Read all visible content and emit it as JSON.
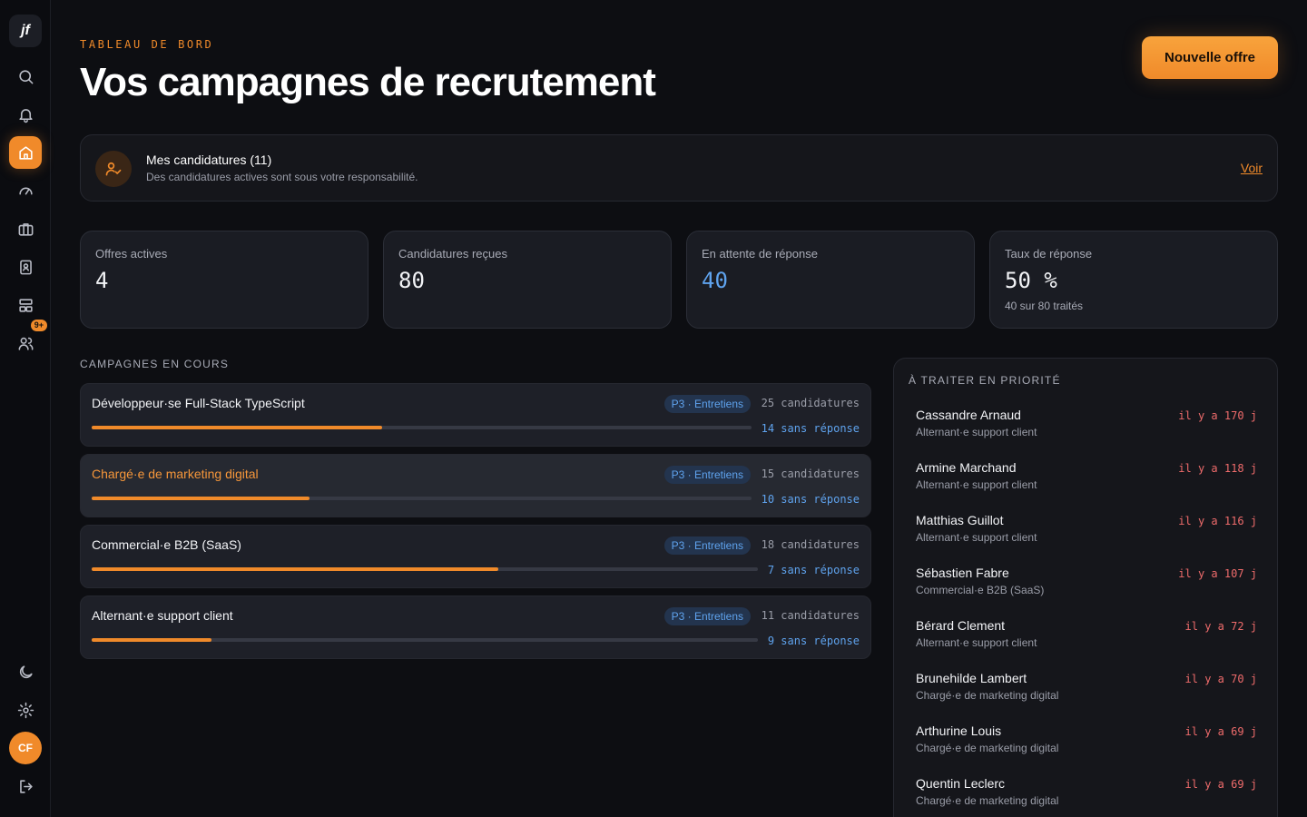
{
  "app": {
    "logo_text": "jf"
  },
  "sidebar": {
    "items": [
      {
        "id": "search",
        "icon": "search-icon"
      },
      {
        "id": "notifications",
        "icon": "bell-icon"
      },
      {
        "id": "home",
        "icon": "home-icon",
        "active": true
      },
      {
        "id": "dashboard",
        "icon": "gauge-icon"
      },
      {
        "id": "jobs",
        "icon": "briefcase-icon"
      },
      {
        "id": "contacts",
        "icon": "contact-book-icon"
      },
      {
        "id": "layout",
        "icon": "layout-icon"
      },
      {
        "id": "team",
        "icon": "users-icon",
        "badge": "9+"
      }
    ],
    "bottom": [
      {
        "id": "theme",
        "icon": "moon-icon"
      },
      {
        "id": "settings",
        "icon": "gear-icon"
      },
      {
        "id": "logout",
        "icon": "logout-icon"
      }
    ],
    "avatar_initials": "CF"
  },
  "header": {
    "eyebrow": "TABLEAU DE BORD",
    "title": "Vos campagnes de recrutement",
    "new_offer_label": "Nouvelle offre"
  },
  "banner": {
    "title": "Mes candidatures (11)",
    "subtitle": "Des candidatures actives sont sous votre responsabilité.",
    "link_label": "Voir"
  },
  "stats": [
    {
      "label": "Offres actives",
      "value": "4"
    },
    {
      "label": "Candidatures reçues",
      "value": "80"
    },
    {
      "label": "En attente de réponse",
      "value": "40"
    },
    {
      "label": "Taux de réponse",
      "value": "50 %",
      "note": "40 sur 80 traités"
    }
  ],
  "campaigns": {
    "section_label": "CAMPAGNES EN COURS",
    "items": [
      {
        "title": "Développeur·se Full-Stack TypeScript",
        "stage": "P3 · Entretiens",
        "count": "25 candidatures",
        "waiting": "14 sans réponse",
        "progress": 0.44
      },
      {
        "title": "Chargé·e de marketing digital",
        "stage": "P3 · Entretiens",
        "count": "15 candidatures",
        "waiting": "10 sans réponse",
        "progress": 0.33
      },
      {
        "title": "Commercial·e B2B (SaaS)",
        "stage": "P3 · Entretiens",
        "count": "18 candidatures",
        "waiting": "7 sans réponse",
        "progress": 0.61
      },
      {
        "title": "Alternant·e support client",
        "stage": "P3 · Entretiens",
        "count": "11 candidatures",
        "waiting": "9 sans réponse",
        "progress": 0.18
      }
    ]
  },
  "priority": {
    "label": "À TRAITER EN PRIORITÉ",
    "items": [
      {
        "name": "Cassandre Arnaud",
        "role": "Alternant·e support client",
        "age": "il y a 170 j"
      },
      {
        "name": "Armine Marchand",
        "role": "Alternant·e support client",
        "age": "il y a 118 j"
      },
      {
        "name": "Matthias Guillot",
        "role": "Alternant·e support client",
        "age": "il y a 116 j"
      },
      {
        "name": "Sébastien Fabre",
        "role": "Commercial·e B2B (SaaS)",
        "age": "il y a 107 j"
      },
      {
        "name": "Bérard Clement",
        "role": "Alternant·e support client",
        "age": "il y a 72 j"
      },
      {
        "name": "Brunehilde Lambert",
        "role": "Chargé·e de marketing digital",
        "age": "il y a 70 j"
      },
      {
        "name": "Arthurine Louis",
        "role": "Chargé·e de marketing digital",
        "age": "il y a 69 j"
      },
      {
        "name": "Quentin Leclerc",
        "role": "Chargé·e de marketing digital",
        "age": "il y a 69 j"
      }
    ]
  },
  "colors": {
    "accent": "#f08a2a",
    "info": "#5fa3ee",
    "danger": "#ee6b6b",
    "background": "#0d0e12"
  }
}
